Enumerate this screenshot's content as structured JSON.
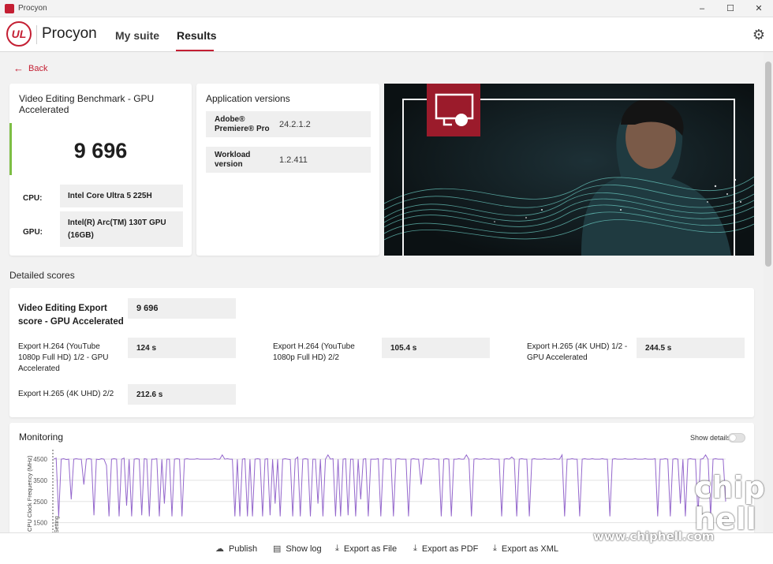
{
  "window": {
    "title": "Procyon",
    "controls": [
      "–",
      "☐",
      "✕"
    ]
  },
  "header": {
    "logo": "UL",
    "app_name": "Procyon",
    "tabs": [
      {
        "label": "My suite"
      },
      {
        "label": "Results"
      }
    ]
  },
  "back": {
    "label": "Back"
  },
  "score_card": {
    "title": "Video Editing Benchmark - GPU Accelerated",
    "score": "9 696",
    "cpu_label": "CPU:",
    "cpu_value": "Intel Core Ultra 5 225H",
    "gpu_label": "GPU:",
    "gpu_value": "Intel(R) Arc(TM) 130T GPU (16GB)"
  },
  "versions": {
    "title": "Application versions",
    "items": [
      {
        "name": "Adobe® Premiere® Pro",
        "value": "24.2.1.2"
      },
      {
        "name": "Workload version",
        "value": "1.2.411"
      }
    ]
  },
  "detailed": {
    "title": "Detailed scores",
    "main_label": "Video Editing Export score - GPU Accelerated",
    "main_value": "9 696",
    "items": [
      {
        "label": "Export H.264 (YouTube 1080p Full HD) 1/2 - GPU Accelerated",
        "value": "124 s"
      },
      {
        "label": "Export H.264 (YouTube 1080p Full HD) 2/2",
        "value": "105.4 s"
      },
      {
        "label": "Export H.265 (4K UHD) 1/2 - GPU Accelerated",
        "value": "244.5 s"
      },
      {
        "label": "Export H.265 (4K UHD) 2/2",
        "value": "212.6 s"
      }
    ]
  },
  "monitoring": {
    "title": "Monitoring",
    "show_details": "Show details",
    "toggle_on": false
  },
  "chart_data": {
    "type": "line",
    "ylabel": "CPU Clock Frequency (MHz)",
    "yticks": [
      1500,
      2500,
      3500,
      4500
    ],
    "ylim": [
      1300,
      4800
    ],
    "marker_label": "Setting",
    "color": "#9467cc",
    "series": [
      {
        "values": [
          4500,
          4550,
          1800,
          4500,
          4520,
          4480,
          4500,
          2600,
          4500,
          4520,
          4500,
          4500,
          3300,
          4500,
          4520,
          4500,
          1850,
          4500,
          4480,
          4520,
          4500,
          4200,
          1800,
          4500,
          4520,
          4500,
          1800,
          4500,
          4550,
          2300,
          4500,
          1800,
          4500,
          4520,
          4500,
          1850,
          4520,
          4500,
          1800,
          4500,
          4500,
          4520,
          1800,
          4500,
          2400,
          4500,
          4500,
          1800,
          4500,
          4520,
          4500,
          1800,
          4500,
          4520,
          4500,
          4500,
          4500,
          4520,
          4500,
          4500,
          4500,
          4500,
          4500,
          4500,
          4520,
          4500,
          4500,
          4700,
          4500,
          4520,
          4500,
          4500,
          1800,
          4500,
          1800,
          4500,
          4520,
          1800,
          4500,
          1800,
          4500,
          4520,
          4500,
          1800,
          4500,
          4520,
          1850,
          4500,
          2400,
          4500,
          1800,
          4500,
          4520,
          4500,
          4480,
          1800,
          4500,
          4600,
          1800,
          4500,
          4520,
          4500,
          1800,
          4500,
          4500,
          2400,
          4500,
          1800,
          4500,
          4700,
          4500,
          4520,
          1800,
          4500,
          1800,
          4500,
          4520,
          1850,
          4500,
          4500,
          1800,
          4500,
          2600,
          4500,
          4520,
          1800,
          4500,
          4500,
          4500,
          4520,
          1800,
          4500,
          4520,
          4500,
          4500,
          1800,
          4500,
          4520,
          4500,
          4500,
          4500,
          1800,
          4500,
          4520,
          4500,
          4500,
          3300,
          4500,
          4520,
          4500,
          4500,
          4520,
          4500,
          4500,
          1800,
          4500,
          4520,
          4500,
          1800,
          4500,
          4500,
          4520,
          4500,
          4500,
          4700,
          4500,
          1800,
          4500,
          4520,
          4500,
          4500,
          4520,
          4500,
          4500,
          4520,
          4500,
          4500,
          4500,
          1800,
          4500,
          4520,
          4500,
          4600,
          4500,
          1800,
          4500,
          4520,
          4500,
          4500,
          1800,
          4500,
          4520,
          4500,
          4500,
          4500,
          4520,
          4500,
          4500,
          4500,
          4520,
          4500,
          4500,
          4700,
          1800,
          4500,
          4500,
          4520,
          4500,
          4500,
          1800,
          4500,
          4520,
          4500,
          4500,
          4520,
          4500,
          4500,
          4500,
          4520,
          4500,
          4500,
          1800,
          4500,
          4520,
          4500,
          4500,
          4500,
          4520,
          4500,
          4500,
          4500,
          4520,
          4500,
          4500,
          4500,
          4520,
          4500,
          4500,
          4500,
          4520,
          1800,
          4500,
          4500,
          4520,
          4500,
          1800,
          4500,
          4520,
          4500,
          2400,
          4500,
          1800,
          4500,
          4520,
          4500,
          4500,
          1800,
          4500,
          4520,
          4700,
          4500,
          1800,
          4500,
          4520,
          4500,
          4500,
          4500,
          2500
        ]
      }
    ],
    "grid": true
  },
  "footer": {
    "buttons": [
      {
        "icon": "publish-icon",
        "label": "Publish"
      },
      {
        "icon": "log-icon",
        "label": "Show log"
      },
      {
        "icon": "download-icon",
        "label": "Export as File"
      },
      {
        "icon": "download-icon",
        "label": "Export as PDF"
      },
      {
        "icon": "download-icon",
        "label": "Export as XML"
      }
    ]
  },
  "watermark": {
    "url": "www.chiphell.com",
    "logo": "chip hell"
  }
}
